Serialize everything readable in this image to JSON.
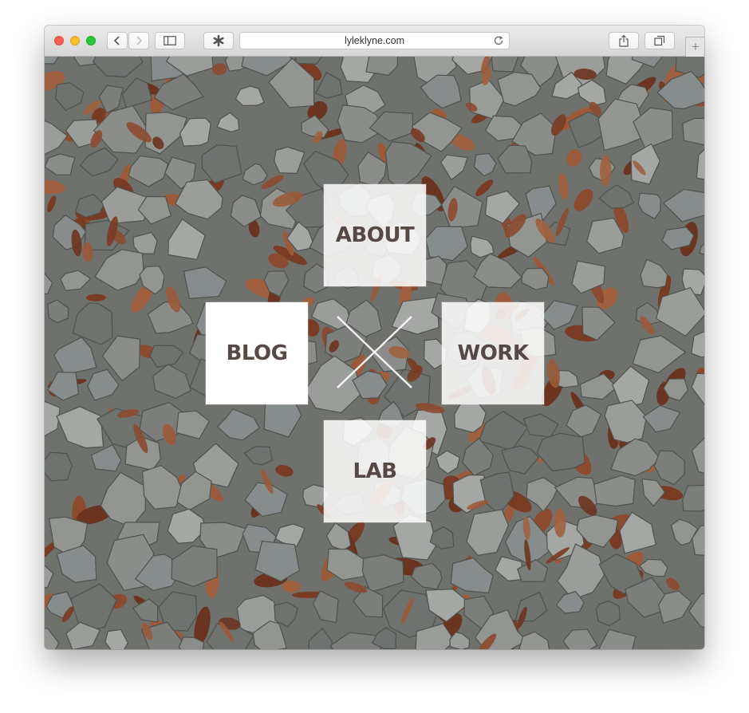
{
  "browser": {
    "url": "lyleklyne.com",
    "new_tab_label": "+"
  },
  "page": {
    "nav": {
      "about": "ABOUT",
      "blog": "BLOG",
      "work": "WORK",
      "lab": "LAB"
    }
  },
  "colors": {
    "tile_text": "#564844",
    "background_stone": "#8a8d89",
    "background_leaf": "#8c4a30"
  }
}
